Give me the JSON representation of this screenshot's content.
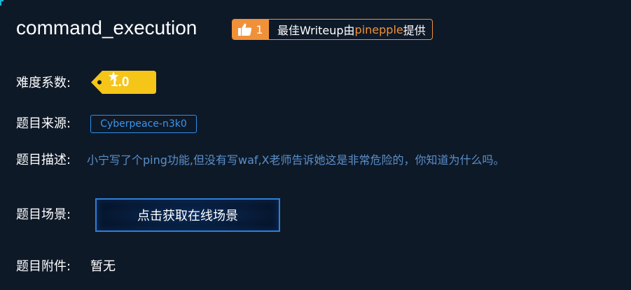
{
  "challenge": {
    "title": "command_execution",
    "writeup_badge": {
      "like_count": "1",
      "prefix": "最佳Writeup由",
      "author": "pinepple",
      "suffix": "提供",
      "accent_color": "#f0913a"
    },
    "difficulty": {
      "label": "难度系数:",
      "value": "1.0",
      "icon": "star-icon",
      "tag_color": "#f5c518"
    },
    "source": {
      "label": "题目来源:",
      "value": "Cyberpeace-n3k0"
    },
    "description": {
      "label": "题目描述:",
      "text": "小宁写了个ping功能,但没有写waf,X老师告诉她这是非常危险的，你知道为什么吗。"
    },
    "scene": {
      "label": "题目场景:",
      "button_label": "点击获取在线场景"
    },
    "attachment": {
      "label": "题目附件:",
      "value": "暂无"
    }
  }
}
